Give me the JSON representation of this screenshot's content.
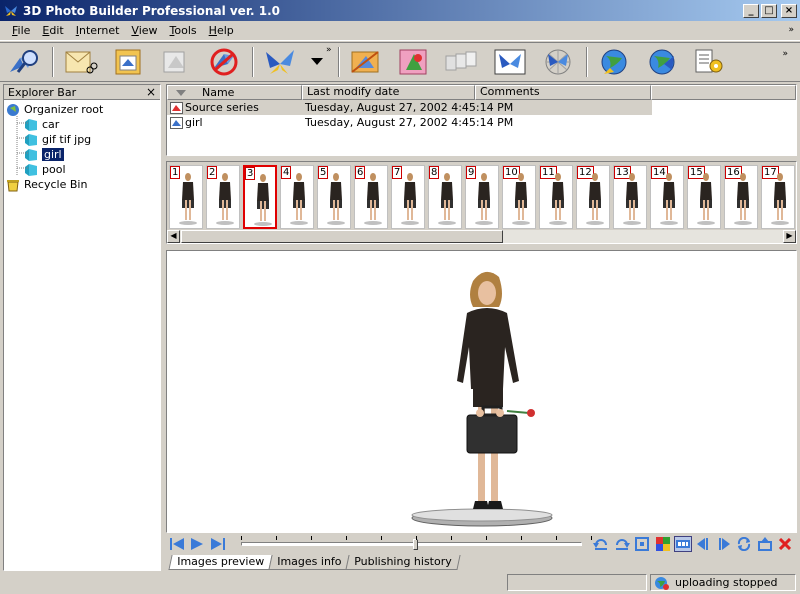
{
  "window": {
    "title": "3D Photo Builder Professional ver. 1.0",
    "minimize": "_",
    "maximize": "□",
    "close": "×"
  },
  "menu": [
    "File",
    "Edit",
    "Internet",
    "View",
    "Tools",
    "Help"
  ],
  "menu_chevron": "»",
  "toolbar": {
    "buttons": [
      "search-icon",
      "cut-icon",
      "paste-icon",
      "copy-icon",
      "delete-icon",
      "butterfly-icon",
      "butterfly-dropdown-icon",
      "crop-icon",
      "color-icon",
      "sequence-icon",
      "butterfly-frame-icon",
      "butterfly-web-icon",
      "globe-refresh-icon",
      "globe-icon",
      "settings-icon"
    ],
    "chevron": "»"
  },
  "explorer": {
    "title": "Explorer Bar",
    "close": "×",
    "tree": [
      {
        "label": "Organizer root",
        "level": 0,
        "icon": "organizer-root-icon"
      },
      {
        "label": "car",
        "level": 1,
        "icon": "folder-icon"
      },
      {
        "label": "gif tif jpg",
        "level": 1,
        "icon": "folder-icon"
      },
      {
        "label": "girl",
        "level": 1,
        "icon": "folder-icon",
        "selected": true
      },
      {
        "label": "pool",
        "level": 1,
        "icon": "folder-icon"
      },
      {
        "label": "Recycle Bin",
        "level": 0,
        "icon": "recycle-bin-icon"
      }
    ]
  },
  "series": {
    "columns": [
      "Name",
      "Last modify date",
      "Comments"
    ],
    "rows": [
      {
        "name": "Source series",
        "date": "Tuesday, August 27, 2002 4:45:14 PM",
        "comments": "",
        "selected": true
      },
      {
        "name": "girl",
        "date": "Tuesday, August 27, 2002 4:45:14 PM",
        "comments": ""
      }
    ]
  },
  "thumbnails": {
    "numbers": [
      "1",
      "2",
      "3",
      "4",
      "5",
      "6",
      "7",
      "8",
      "9",
      "10",
      "11",
      "12",
      "13",
      "14",
      "15",
      "16",
      "17",
      "1"
    ],
    "selected_index": 2
  },
  "tabs": [
    "Images preview",
    "Images info",
    "Publishing history"
  ],
  "status": {
    "text": "uploading stopped"
  },
  "colors": {
    "title_start": "#0a246a",
    "title_end": "#a6caf0",
    "selection": "#0a246a",
    "thumb_selected": "#e00000"
  }
}
